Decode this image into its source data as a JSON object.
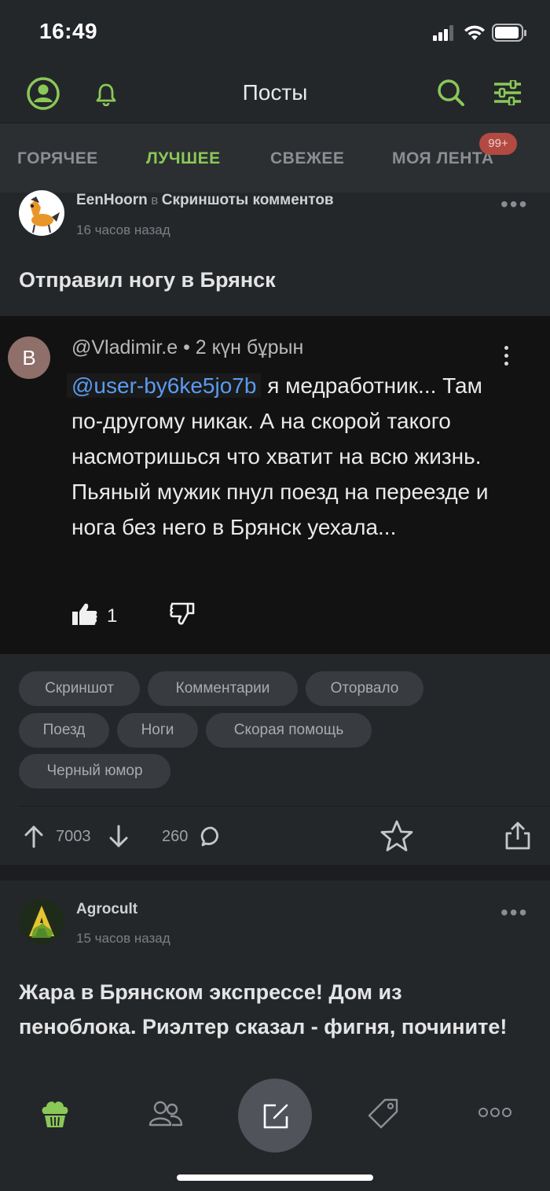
{
  "status_bar": {
    "time": "16:49"
  },
  "header": {
    "title": "Посты"
  },
  "tabs": [
    {
      "label": "ГОРЯЧЕЕ",
      "active": false
    },
    {
      "label": "ЛУЧШЕЕ",
      "active": true
    },
    {
      "label": "СВЕЖЕЕ",
      "active": false
    },
    {
      "label": "МОЯ ЛЕНТА",
      "active": false,
      "badge": "99+"
    }
  ],
  "post1": {
    "author": "EenHoorn",
    "in_word": "в",
    "community": "Скриншоты комментов",
    "time": "16 часов назад",
    "title": "Отправил ногу в Брянск",
    "screenshot": {
      "avatar_letter": "B",
      "header": "@Vladimir.e • 2 күн бұрын",
      "mention": "@user-by6ke5jo7b",
      "text": " я медработник... Там по-другому никак. А на скорой такого насмотришься что  хватит на всю жизнь. Пьяный мужик пнул поезд на переезде и нога без него в Брянск уехала...",
      "likes": "1"
    },
    "tags": [
      "Скриншот",
      "Комментарии",
      "Оторвало",
      "Поезд",
      "Ноги",
      "Скорая помощь",
      "Черный юмор"
    ],
    "rating": "7003",
    "comments": "260"
  },
  "post2": {
    "author": "Agrocult",
    "time": "15 часов назад",
    "title": "Жара в Брянском экспрессе! Дом из пеноблока. Риэлтер сказал - фигня, почините!"
  },
  "colors": {
    "accent": "#8ac858",
    "background": "#24272a",
    "badge": "#b24a42"
  }
}
